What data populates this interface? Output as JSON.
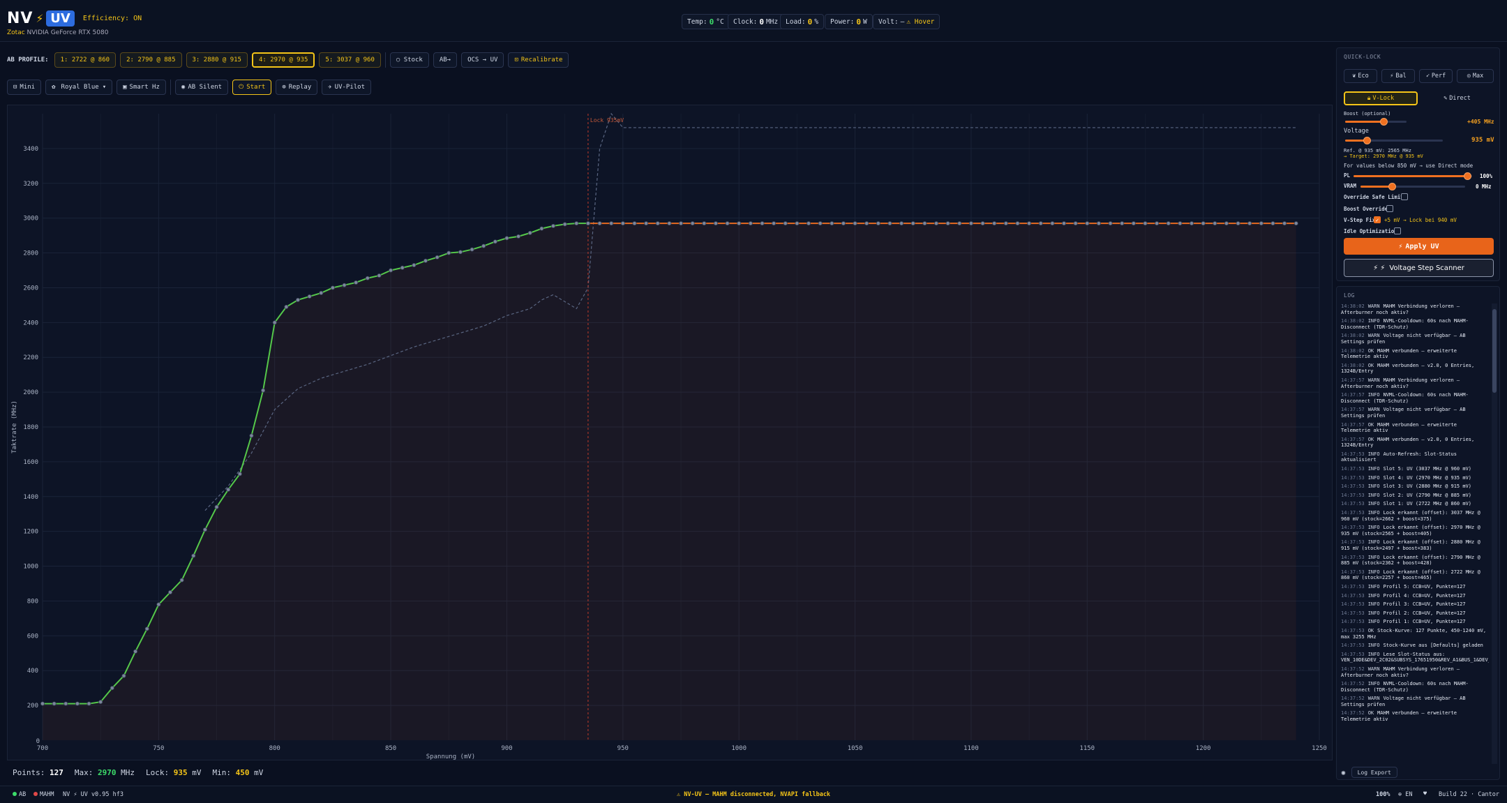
{
  "header": {
    "logo_nv": "NV",
    "logo_bolt": "⚡",
    "logo_uv": "UV",
    "efficiency": "Efficiency: ON",
    "vendor": "Zotac",
    "gpu": "NVIDIA GeForce RTX 5080",
    "telemetry": {
      "temp_label": "Temp:",
      "temp_value": "0",
      "temp_unit": "°C",
      "clock_label": "Clock:",
      "clock_value": "0",
      "clock_unit": "MHz",
      "load_label": "Load:",
      "load_value": "0",
      "load_unit": "%",
      "power_label": "Power:",
      "power_value": "0",
      "power_unit": "W",
      "volt_label": "Volt:",
      "volt_value": "—",
      "volt_hover": "⚠ Hover"
    }
  },
  "profile_bar": {
    "label": "AB PROFILE:",
    "slots": [
      "1: 2722 @ 860",
      "2: 2790 @ 885",
      "3: 2880 @ 915",
      "4: 2970 @ 935",
      "5: 3037 @ 960"
    ],
    "active_slot": 3,
    "stock": "○ Stock",
    "ab_toggle": "AB→",
    "ocs_uv": "OCS → UV",
    "recalibrate": "Recalibrate"
  },
  "tool_bar": {
    "mini": "Mini",
    "theme": "Royal Blue",
    "smart_hz": "Smart Hz",
    "ab_silent": "AB Silent",
    "start": "Start",
    "replay": "Replay",
    "uv_pilot": "UV-Pilot"
  },
  "chart_data": {
    "type": "line",
    "title": "",
    "xlabel": "Spannung (mV)",
    "ylabel": "Taktrate (MHz)",
    "xlim": [
      700,
      1250
    ],
    "ylim": [
      0,
      3600
    ],
    "x_ticks": [
      700,
      750,
      800,
      850,
      900,
      950,
      1000,
      1050,
      1100,
      1150,
      1200,
      1250
    ],
    "y_ticks": [
      200,
      400,
      600,
      800,
      1000,
      1200,
      1400,
      1600,
      1800,
      2000,
      2200,
      2400,
      2600,
      2800,
      3000,
      3200,
      3400
    ],
    "lock_line": {
      "x": 935,
      "label": "Lock 935mV"
    },
    "grid": true,
    "series": [
      {
        "name": "",
        "color": "#55c84a",
        "x": [
          700,
          705,
          710,
          715,
          720,
          725,
          730,
          735,
          740,
          745,
          750,
          755,
          760,
          765,
          770,
          775,
          780,
          785,
          790,
          795,
          800,
          805,
          810,
          815,
          820,
          825,
          830,
          835,
          840,
          845,
          850,
          855,
          860,
          865,
          870,
          875,
          880,
          885,
          890,
          895,
          900,
          905,
          910,
          915,
          920,
          925,
          930,
          935
        ],
        "y": [
          210,
          210,
          210,
          210,
          210,
          220,
          300,
          370,
          510,
          640,
          780,
          850,
          920,
          1060,
          1210,
          1340,
          1440,
          1530,
          1750,
          2010,
          2400,
          2490,
          2530,
          2550,
          2570,
          2600,
          2615,
          2630,
          2655,
          2670,
          2700,
          2715,
          2730,
          2755,
          2775,
          2800,
          2805,
          2820,
          2840,
          2865,
          2885,
          2895,
          2915,
          2940,
          2955,
          2965,
          2970,
          2970
        ]
      },
      {
        "name": "",
        "color": "#e86a20",
        "x": [
          935,
          940,
          945,
          950,
          955,
          960,
          965,
          970,
          975,
          980,
          985,
          990,
          995,
          1000,
          1005,
          1010,
          1015,
          1020,
          1025,
          1030,
          1035,
          1040,
          1045,
          1050,
          1055,
          1060,
          1065,
          1070,
          1075,
          1080,
          1085,
          1090,
          1095,
          1100,
          1105,
          1110,
          1115,
          1120,
          1125,
          1130,
          1135,
          1140,
          1145,
          1150,
          1155,
          1160,
          1165,
          1170,
          1175,
          1180,
          1185,
          1190,
          1195,
          1200,
          1205,
          1210,
          1215,
          1220,
          1225,
          1230,
          1235,
          1240
        ],
        "y": [
          2970,
          2970,
          2970,
          2970,
          2970,
          2970,
          2970,
          2970,
          2970,
          2970,
          2970,
          2970,
          2970,
          2970,
          2970,
          2970,
          2970,
          2970,
          2970,
          2970,
          2970,
          2970,
          2970,
          2970,
          2970,
          2970,
          2970,
          2970,
          2970,
          2970,
          2970,
          2970,
          2970,
          2970,
          2970,
          2970,
          2970,
          2970,
          2970,
          2970,
          2970,
          2970,
          2970,
          2970,
          2970,
          2970,
          2970,
          2970,
          2970,
          2970,
          2970,
          2970,
          2970,
          2970,
          2970,
          2970,
          2970,
          2970,
          2970,
          2970,
          2970,
          2970
        ]
      },
      {
        "name": "",
        "color": "#5a6682",
        "dashed": true,
        "x": [
          770,
          780,
          790,
          800,
          810,
          820,
          830,
          840,
          850,
          860,
          870,
          880,
          890,
          900,
          910,
          915,
          920,
          925,
          930,
          935,
          940,
          945,
          950,
          960,
          980,
          1000,
          1050,
          1100,
          1150,
          1200,
          1240
        ],
        "y": [
          1320,
          1460,
          1650,
          1900,
          2020,
          2080,
          2120,
          2160,
          2210,
          2260,
          2300,
          2340,
          2380,
          2440,
          2480,
          2530,
          2560,
          2520,
          2480,
          2600,
          3400,
          3600,
          3520,
          3520,
          3520,
          3520,
          3520,
          3520,
          3520,
          3520,
          3520
        ]
      }
    ]
  },
  "stats": {
    "points_label": "Points:",
    "points": "127",
    "max_label": "Max:",
    "max": "2970",
    "max_unit": "MHz",
    "lock_label": "Lock:",
    "lock": "935",
    "lock_unit": "mV",
    "min_label": "Min:",
    "min": "450",
    "min_unit": "mV"
  },
  "quick_lock": {
    "title": "QUICK-LOCK",
    "modes": [
      "Eco",
      "Bal",
      "Perf",
      "Max"
    ],
    "vlock": "V-Lock",
    "direct": "Direct",
    "boost_label": "Boost (optional)",
    "boost_value": "+405 MHz",
    "boost_level": 0.62,
    "voltage_label": "Voltage",
    "voltage_value": "935 mV",
    "voltage_level": 0.22,
    "ref_line": "Ref. @ 935 mV: 2565 MHz",
    "target_line": "→ Target: 2970 MHz @ 935 mV",
    "note": "For values below 850 mV → use Direct mode",
    "pl_label": "PL",
    "pl_value": "100%",
    "pl_level": 0.96,
    "vram_label": "VRAM",
    "vram_value": "0 MHz",
    "vram_level": 0.3,
    "override_safe": "Override Safe Limit",
    "boost_override": "Boost Override",
    "vstep_fix": "V-Step Fix",
    "vstep_note": "+5 mV → Lock bei 940 mV",
    "idle_opt": "Idle Optimization",
    "apply": "Apply UV",
    "scanner": "Voltage Step Scanner"
  },
  "log": {
    "title": "LOG",
    "export": "Log Export",
    "entries": [
      {
        "t": "14:38:02",
        "lvl": "WARN",
        "msg": "MAHM Verbindung verloren — Afterburner noch aktiv?"
      },
      {
        "t": "14:38:02",
        "lvl": "INFO",
        "msg": "NVML-Cooldown: 60s nach MAHM-Disconnect (TDR-Schutz)"
      },
      {
        "t": "14:38:02",
        "lvl": "WARN",
        "msg": "Voltage nicht verfügbar — AB Settings prüfen"
      },
      {
        "t": "14:38:02",
        "lvl": "OK",
        "msg": "MAHM verbunden — erweiterte Telemetrie aktiv"
      },
      {
        "t": "14:38:02",
        "lvl": "OK",
        "msg": "MAHM verbunden — v2.0, 0 Entries, 1324B/Entry"
      },
      {
        "t": "14:37:57",
        "lvl": "WARN",
        "msg": "MAHM Verbindung verloren — Afterburner noch aktiv?"
      },
      {
        "t": "14:37:57",
        "lvl": "INFO",
        "msg": "NVML-Cooldown: 60s nach MAHM-Disconnect (TDR-Schutz)"
      },
      {
        "t": "14:37:57",
        "lvl": "WARN",
        "msg": "Voltage nicht verfügbar — AB Settings prüfen"
      },
      {
        "t": "14:37:57",
        "lvl": "OK",
        "msg": "MAHM verbunden — erweiterte Telemetrie aktiv"
      },
      {
        "t": "14:37:57",
        "lvl": "OK",
        "msg": "MAHM verbunden — v2.0, 0 Entries, 1324B/Entry"
      },
      {
        "t": "14:37:53",
        "lvl": "INFO",
        "msg": "Auto-Refresh: Slot-Status aktualisiert"
      },
      {
        "t": "14:37:53",
        "lvl": "INFO",
        "msg": "Slot 5: UV (3037 MHz @ 960 mV)"
      },
      {
        "t": "14:37:53",
        "lvl": "INFO",
        "msg": "Slot 4: UV (2970 MHz @ 935 mV)"
      },
      {
        "t": "14:37:53",
        "lvl": "INFO",
        "msg": "Slot 3: UV (2880 MHz @ 915 mV)"
      },
      {
        "t": "14:37:53",
        "lvl": "INFO",
        "msg": "Slot 2: UV (2790 MHz @ 885 mV)"
      },
      {
        "t": "14:37:53",
        "lvl": "INFO",
        "msg": "Slot 1: UV (2722 MHz @ 860 mV)"
      },
      {
        "t": "14:37:53",
        "lvl": "INFO",
        "msg": "Lock erkannt (offset): 3037 MHz @ 960 mV (stock=2662 + boost=375)"
      },
      {
        "t": "14:37:53",
        "lvl": "INFO",
        "msg": "Lock erkannt (offset): 2970 MHz @ 935 mV (stock=2565 + boost=405)"
      },
      {
        "t": "14:37:53",
        "lvl": "INFO",
        "msg": "Lock erkannt (offset): 2880 MHz @ 915 mV (stock=2497 + boost=383)"
      },
      {
        "t": "14:37:53",
        "lvl": "INFO",
        "msg": "Lock erkannt (offset): 2790 MHz @ 885 mV (stock=2362 + boost=428)"
      },
      {
        "t": "14:37:53",
        "lvl": "INFO",
        "msg": "Lock erkannt (offset): 2722 MHz @ 860 mV (stock=2257 + boost=465)"
      },
      {
        "t": "14:37:53",
        "lvl": "INFO",
        "msg": "Profil 5: CCB=UV, Punkte=127"
      },
      {
        "t": "14:37:53",
        "lvl": "INFO",
        "msg": "Profil 4: CCB=UV, Punkte=127"
      },
      {
        "t": "14:37:53",
        "lvl": "INFO",
        "msg": "Profil 3: CCB=UV, Punkte=127"
      },
      {
        "t": "14:37:53",
        "lvl": "INFO",
        "msg": "Profil 2: CCB=UV, Punkte=127"
      },
      {
        "t": "14:37:53",
        "lvl": "INFO",
        "msg": "Profil 1: CCB=UV, Punkte=127"
      },
      {
        "t": "14:37:53",
        "lvl": "OK",
        "msg": "Stock-Kurve: 127 Punkte, 450-1240 mV, max 3255 MHz"
      },
      {
        "t": "14:37:53",
        "lvl": "INFO",
        "msg": "Stock-Kurve aus [Defaults] geladen"
      },
      {
        "t": "14:37:53",
        "lvl": "INFO",
        "msg": "Lese Slot-Status aus: VEN_10DE&DEV_2C02&SUBSYS_17651950&REV_A1&BUS_1&DEV_0&FN_0.cfg"
      },
      {
        "t": "14:37:52",
        "lvl": "WARN",
        "msg": "MAHM Verbindung verloren — Afterburner noch aktiv?"
      },
      {
        "t": "14:37:52",
        "lvl": "INFO",
        "msg": "NVML-Cooldown: 60s nach MAHM-Disconnect (TDR-Schutz)"
      },
      {
        "t": "14:37:52",
        "lvl": "WARN",
        "msg": "Voltage nicht verfügbar — AB Settings prüfen"
      },
      {
        "t": "14:37:52",
        "lvl": "OK",
        "msg": "MAHM verbunden — erweiterte Telemetrie aktiv"
      }
    ]
  },
  "footer": {
    "ab": "AB",
    "mahm": "MAHM",
    "version": "NV ⚡ UV v0.95 hf3",
    "status": "⚠ NV-UV — MAHM disconnected, NVAPI fallback",
    "zoom": "100%",
    "lang": "EN",
    "build": "Build 22 · Cantor",
    "colors": {
      "ab_dot": "#3ddc6a",
      "mahm_dot": "#e04848",
      "status": "#f5c518"
    }
  }
}
